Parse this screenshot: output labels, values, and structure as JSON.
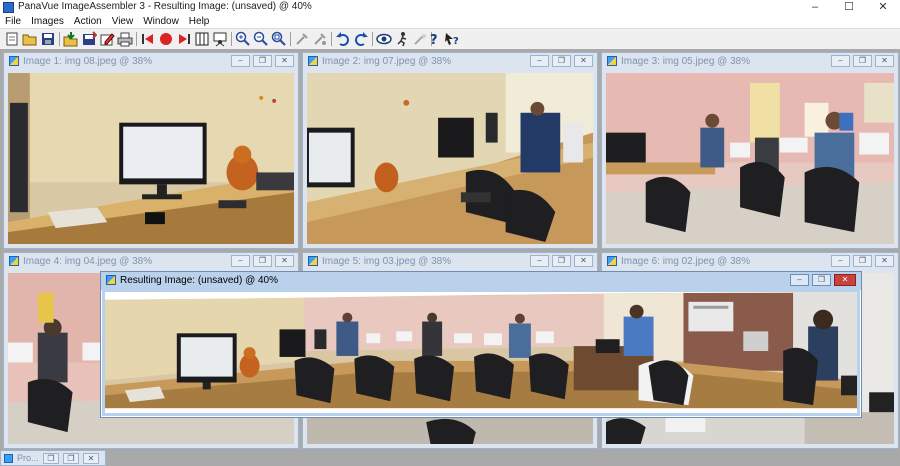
{
  "window": {
    "title": "PanaVue ImageAssembler 3 - Resulting Image: (unsaved) @ 40%",
    "controls": {
      "minimize": "–",
      "maximize": "☐",
      "close": "✕"
    }
  },
  "menu": [
    "File",
    "Images",
    "Action",
    "View",
    "Window",
    "Help"
  ],
  "toolbar": {
    "icons": [
      "new-icon",
      "open-icon",
      "save-icon",
      "import-icon",
      "export-icon",
      "edit-icon",
      "print-icon",
      "prev-icon",
      "record-icon",
      "next-icon",
      "columns-icon",
      "person-icon",
      "zoom-in-icon",
      "zoom-out-icon",
      "zoom-fit-icon",
      "tools-icon",
      "tools2-icon",
      "undo-icon",
      "redo-icon",
      "eye-icon",
      "run-icon",
      "magic-icon",
      "help-icon",
      "context-help-icon"
    ]
  },
  "subwindows": [
    {
      "title": "Image 1: img 08.jpeg @ 38%"
    },
    {
      "title": "Image 2: img 07.jpeg @ 38%"
    },
    {
      "title": "Image 3: img 05.jpeg @ 38%"
    },
    {
      "title": "Image 4: img 04.jpeg @ 38%"
    },
    {
      "title": "Image 5: img 03.jpeg @ 38%"
    },
    {
      "title": "Image 6: img 02.jpeg @ 38%"
    }
  ],
  "result_window": {
    "title": "Resulting Image: (unsaved) @ 40%"
  },
  "minimized": {
    "title": "Pro..."
  },
  "subwindow_buttons": {
    "minimize": "–",
    "restore": "❐",
    "close": "✕"
  }
}
